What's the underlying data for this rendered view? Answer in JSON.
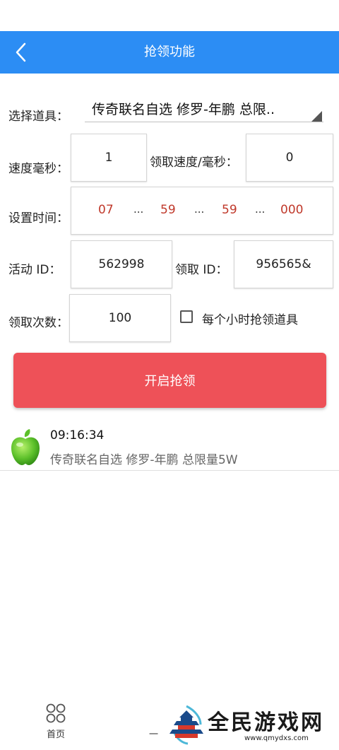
{
  "header": {
    "title": "抢领功能",
    "back_icon": "chevron-left-icon"
  },
  "form": {
    "item_label": "选择道具：",
    "item_value": "传奇联名自选 修罗-年鹏 总限..",
    "speed_label": "速度毫秒：",
    "speed_value": "1",
    "claim_speed_label": "领取速度/毫秒：",
    "claim_speed_value": "0",
    "time_label": "设置时间：",
    "time": {
      "hour": "07",
      "minute": "59",
      "second": "59",
      "ms": "000",
      "sep": "..."
    },
    "activity_label": "活动  ID：",
    "activity_value": "562998",
    "claim_id_label": "领取  ID：",
    "claim_id_value": "956565&",
    "count_label": "领取次数：",
    "count_value": "100",
    "hourly_label": "每个小时抢领道具",
    "hourly_checked": false
  },
  "start_button": {
    "label": "开启抢领",
    "color": "#ee5158"
  },
  "log": {
    "time": "09:16:34",
    "text": "传奇联名自选 修罗-年鹏 总限量5W",
    "icon": "apple-icon"
  },
  "nav": {
    "home_label": "首页",
    "second_label": "一"
  },
  "watermark": {
    "text": "全民游戏网",
    "url": "www.qmydxs.com"
  },
  "colors": {
    "header": "#2c8df4",
    "time_values": "#c0392b"
  }
}
